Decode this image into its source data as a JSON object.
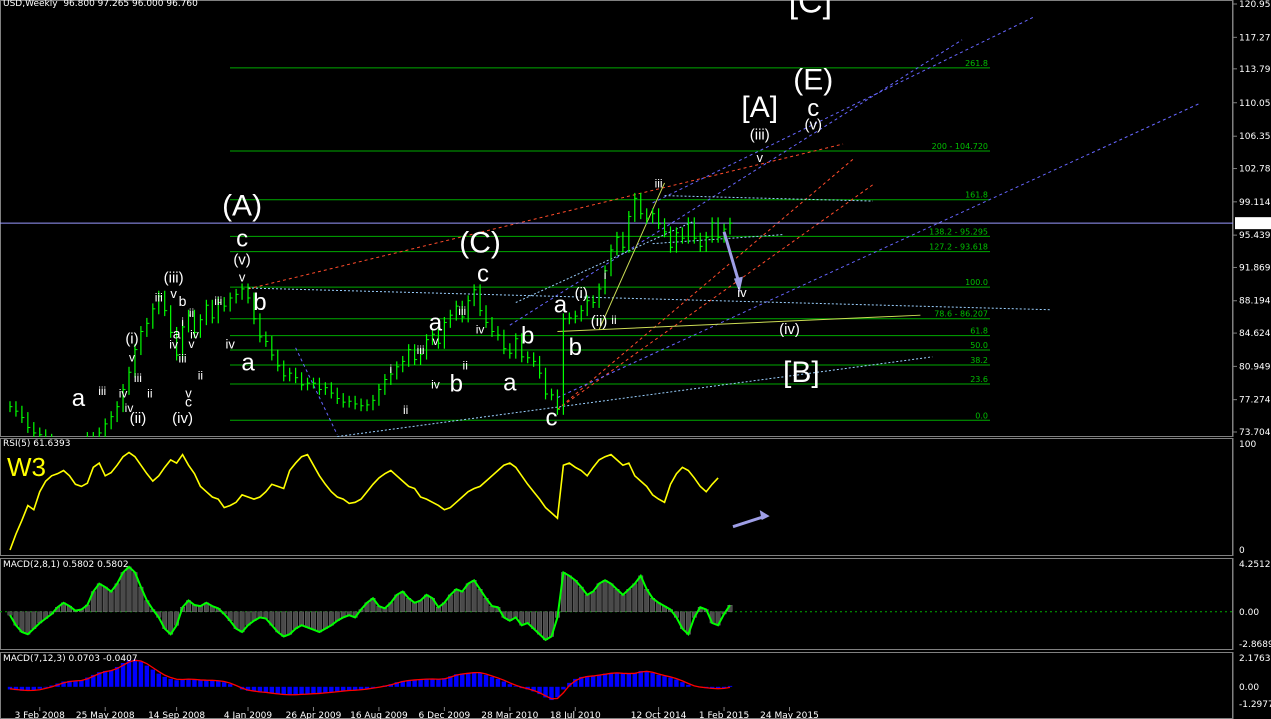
{
  "header": {
    "symbol_text": "USD,Weekly",
    "ohlc_text": "96.800 97.265 96.000 96.760"
  },
  "colors": {
    "bg": "#000000",
    "price": "#00ff00",
    "rsi": "#ffff00",
    "macd_line": "#00ff00",
    "hist": "#4a4a4a",
    "macd2_hist": "#0000ff",
    "macd2_signal": "#ff0000",
    "fib": "#00aa00",
    "current_line": "#9999ff"
  },
  "chart_data": [
    {
      "type": "line",
      "title": "USD,Weekly",
      "ylim": [
        73.704,
        120.955
      ],
      "y_ticks": [
        "120.955",
        "117.275",
        "113.797",
        "110.053",
        "106.359",
        "102.789",
        "99.114",
        "95.439",
        "91.869",
        "88.194",
        "84.624",
        "80.949",
        "77.274",
        "73.704"
      ],
      "current_price": "96.760",
      "x_ticks": [
        "3 Feb 2008",
        "25 May 2008",
        "14 Sep 2008",
        "4 Jan 2009",
        "26 Apr 2009",
        "16 Aug 2009",
        "6 Dec 2009",
        "28 Mar 2010",
        "18 Jul 2010",
        "12 Oct 2014",
        "1 Feb 2015",
        "24 May 2015"
      ],
      "x_tick_idx": [
        5,
        16,
        28,
        40,
        51,
        62,
        73,
        84,
        95,
        109,
        120,
        131
      ],
      "series": [
        {
          "values": [
            76.5,
            76,
            75.3,
            74.2,
            73.6,
            73.4,
            72.9,
            72.4,
            72.2,
            71.5,
            71,
            71.5,
            72.3,
            73.1,
            73,
            73.6,
            74.6,
            75.4,
            76.5,
            78.4,
            80.3,
            82.8,
            84.8,
            85.7,
            87.3,
            88.7,
            87.1,
            84.7,
            82.2,
            85.3,
            86.6,
            84.7,
            86.1,
            87.7,
            86.3,
            88,
            87.6,
            88.5,
            88.9,
            89.5,
            88.5,
            86.2,
            84.2,
            83.7,
            82.2,
            81,
            79.9,
            80.2,
            79.7,
            78.9,
            79.1,
            79.1,
            78.4,
            78.6,
            78,
            77.4,
            77,
            77.1,
            76.8,
            76.6,
            76.7,
            77.2,
            78.4,
            79.5,
            80.1,
            80.9,
            81.5,
            82.8,
            81.7,
            82.3,
            83.9,
            84.5,
            83.5,
            85.8,
            86.6,
            87.6,
            86.4,
            88.2,
            89.4,
            87.1,
            85.8,
            84.8,
            84.4,
            82.9,
            82.4,
            84,
            82,
            81.9,
            81.5,
            80.2,
            77.9,
            77.8,
            76.2,
            86.2,
            86.3,
            86.5,
            87.1,
            88.2,
            88,
            89.5,
            91.5,
            93.8,
            95.2,
            94.1,
            97.5,
            99.5,
            97.8,
            97.3,
            97.8,
            96.7,
            95.8,
            94.1,
            95.7,
            95.1,
            96.8,
            95.1,
            94.2,
            95.2,
            96.8,
            95.2,
            96.1,
            96.76
          ]
        }
      ],
      "fib_levels": [
        {
          "label": "261.8",
          "value": 113.9
        },
        {
          "label": "200 - 104.720",
          "value": 104.72
        },
        {
          "label": "161.8",
          "value": 99.35
        },
        {
          "label": "138.2 - 95.295",
          "value": 95.295
        },
        {
          "label": "127.2 - 93.618",
          "value": 93.618
        },
        {
          "label": "100.0",
          "value": 89.7
        },
        {
          "label": "78.6 - 86.207",
          "value": 86.207
        },
        {
          "label": "61.8",
          "value": 84.35
        },
        {
          "label": "50.0",
          "value": 82.75
        },
        {
          "label": "38.2",
          "value": 81.1
        },
        {
          "label": "23.6",
          "value": 79.0
        },
        {
          "label": "0.0",
          "value": 75.0
        }
      ],
      "annotations": [
        {
          "t": "[C]",
          "c": "#c8902c",
          "s": 34,
          "i": 134.5,
          "v": 120.0
        },
        {
          "t": "[A]",
          "c": "#c8902c",
          "s": 30,
          "i": 126,
          "v": 108.5
        },
        {
          "t": "(E)",
          "c": "#22b0e8",
          "s": 30,
          "i": 135,
          "v": 111.5
        },
        {
          "t": "c",
          "c": "#ff22dd",
          "s": 24,
          "i": 135,
          "v": 108.6
        },
        {
          "t": "(v)",
          "c": "#ff1010",
          "s": 15,
          "i": 135,
          "v": 107.1
        },
        {
          "t": "(iii)",
          "c": "#ff1010",
          "s": 15,
          "i": 126,
          "v": 106.0
        },
        {
          "t": "v",
          "c": "#ffcc00",
          "s": 13,
          "i": 126,
          "v": 103.5
        },
        {
          "t": "iii",
          "c": "#ffcc00",
          "s": 12,
          "i": 109,
          "v": 100.7
        },
        {
          "t": "iv",
          "c": "#ffcc00",
          "s": 13,
          "i": 123,
          "v": 88.6
        },
        {
          "t": "(iv)",
          "c": "#ff1010",
          "s": 15,
          "i": 131,
          "v": 84.5
        },
        {
          "t": "[B]",
          "c": "#c8902c",
          "s": 30,
          "i": 133,
          "v": 79.2
        },
        {
          "t": "(A)",
          "c": "#22b0e8",
          "s": 30,
          "i": 39,
          "v": 97.6
        },
        {
          "t": "c",
          "c": "#ff22dd",
          "s": 24,
          "i": 39,
          "v": 94.2
        },
        {
          "t": "(v)",
          "c": "#ff1010",
          "s": 15,
          "i": 39,
          "v": 92.2
        },
        {
          "t": "v",
          "c": "#ffcc00",
          "s": 13,
          "i": 39,
          "v": 90.3
        },
        {
          "t": "b",
          "c": "#ff22dd",
          "s": 24,
          "i": 42,
          "v": 87.2
        },
        {
          "t": "a",
          "c": "#ff22dd",
          "s": 24,
          "i": 40,
          "v": 80.5
        },
        {
          "t": "iv",
          "c": "#ffcc00",
          "s": 13,
          "i": 37,
          "v": 82.9
        },
        {
          "t": "iii",
          "c": "#ffcc00",
          "s": 12,
          "i": 35,
          "v": 87.7
        },
        {
          "t": "(iii)",
          "c": "#ff1010",
          "s": 15,
          "i": 27.5,
          "v": 90.2
        },
        {
          "t": "iii",
          "c": "#ffcc00",
          "s": 12,
          "i": 25,
          "v": 88.1
        },
        {
          "t": "v",
          "c": "#ffcc00",
          "s": 13,
          "i": 27.5,
          "v": 88.5
        },
        {
          "t": "b",
          "c": "#22b0e8",
          "s": 14,
          "i": 29,
          "v": 87.6
        },
        {
          "t": "a",
          "c": "#22b0e8",
          "s": 14,
          "i": 28,
          "v": 84.0
        },
        {
          "t": "ii",
          "c": "#ffcc00",
          "s": 12,
          "i": 30.5,
          "v": 86.4
        },
        {
          "t": "i",
          "c": "#ffcc00",
          "s": 12,
          "i": 29,
          "v": 85.4
        },
        {
          "t": "iv",
          "c": "#ffcc00",
          "s": 12,
          "i": 27.5,
          "v": 82.9
        },
        {
          "t": "iv",
          "c": "#ffcc00",
          "s": 12,
          "i": 31,
          "v": 84.0
        },
        {
          "t": "v",
          "c": "#ffcc00",
          "s": 12,
          "i": 30.5,
          "v": 83.0
        },
        {
          "t": "iii",
          "c": "#ffcc00",
          "s": 12,
          "i": 29,
          "v": 81.4
        },
        {
          "t": "ii",
          "c": "#ffcc00",
          "s": 12,
          "i": 32,
          "v": 79.5
        },
        {
          "t": "v",
          "c": "#ffcc00",
          "s": 13,
          "i": 30,
          "v": 77.5
        },
        {
          "t": "c",
          "c": "#22b0e8",
          "s": 14,
          "i": 30,
          "v": 76.5
        },
        {
          "t": "(i)",
          "c": "#ff1010",
          "s": 15,
          "i": 20.5,
          "v": 83.5
        },
        {
          "t": "v",
          "c": "#ffcc00",
          "s": 12,
          "i": 20.5,
          "v": 81.5
        },
        {
          "t": "iii",
          "c": "#ffcc00",
          "s": 12,
          "i": 21.5,
          "v": 79.2
        },
        {
          "t": "iv",
          "c": "#ffcc00",
          "s": 12,
          "i": 19,
          "v": 77.5
        },
        {
          "t": "iii",
          "c": "#ffcc00",
          "s": 12,
          "i": 15.5,
          "v": 77.8
        },
        {
          "t": "ii",
          "c": "#ffcc00",
          "s": 12,
          "i": 23.5,
          "v": 77.5
        },
        {
          "t": "iv",
          "c": "#ffcc00",
          "s": 12,
          "i": 20,
          "v": 75.9
        },
        {
          "t": "(ii)",
          "c": "#ff1010",
          "s": 15,
          "i": 21.5,
          "v": 74.7
        },
        {
          "t": "(iv)",
          "c": "#ff1010",
          "s": 15,
          "i": 29,
          "v": 74.7
        },
        {
          "t": "a",
          "c": "#ff22dd",
          "s": 24,
          "i": 11.5,
          "v": 76.6
        },
        {
          "t": "(C)",
          "c": "#22b0e8",
          "s": 30,
          "i": 79,
          "v": 93.5
        },
        {
          "t": "c",
          "c": "#ff22dd",
          "s": 24,
          "i": 79.5,
          "v": 90.3
        },
        {
          "t": "iii",
          "c": "#ffcc00",
          "s": 12,
          "i": 76,
          "v": 86.6
        },
        {
          "t": "iv",
          "c": "#ffcc00",
          "s": 12,
          "i": 79,
          "v": 84.6
        },
        {
          "t": "a",
          "c": "#ff22dd",
          "s": 24,
          "i": 71.5,
          "v": 84.9
        },
        {
          "t": "v",
          "c": "#ffcc00",
          "s": 12,
          "i": 71.5,
          "v": 83.3
        },
        {
          "t": "iii",
          "c": "#ffcc00",
          "s": 12,
          "i": 69,
          "v": 82.3
        },
        {
          "t": "ii",
          "c": "#ffcc00",
          "s": 12,
          "i": 76.5,
          "v": 80.6
        },
        {
          "t": "i",
          "c": "#ffcc00",
          "s": 12,
          "i": 64,
          "v": 80.2
        },
        {
          "t": "iv",
          "c": "#ffcc00",
          "s": 12,
          "i": 71.5,
          "v": 78.5
        },
        {
          "t": "b",
          "c": "#ff22dd",
          "s": 24,
          "i": 75,
          "v": 78.2
        },
        {
          "t": "ii",
          "c": "#ffcc00",
          "s": 12,
          "i": 66.5,
          "v": 75.7
        },
        {
          "t": "a",
          "c": "#ff22dd",
          "s": 24,
          "i": 84,
          "v": 78.3
        },
        {
          "t": "b",
          "c": "#ff22dd",
          "s": 24,
          "i": 87,
          "v": 83.5
        },
        {
          "t": "c",
          "c": "#ff22dd",
          "s": 24,
          "i": 91,
          "v": 74.4
        },
        {
          "t": "a",
          "c": "#ff22dd",
          "s": 24,
          "i": 92.5,
          "v": 86.9
        },
        {
          "t": "(i)",
          "c": "#ff1010",
          "s": 15,
          "i": 96,
          "v": 88.5
        },
        {
          "t": "b",
          "c": "#ff22dd",
          "s": 24,
          "i": 95,
          "v": 82.2
        },
        {
          "t": "i",
          "c": "#ffcc00",
          "s": 12,
          "i": 100,
          "v": 90.6
        },
        {
          "t": "ii",
          "c": "#ffcc00",
          "s": 12,
          "i": 101.5,
          "v": 85.6
        },
        {
          "t": "(ii)",
          "c": "#ff1010",
          "s": 15,
          "i": 99,
          "v": 85.4
        }
      ]
    },
    {
      "type": "line",
      "title": "RSI(5) 61.6393",
      "ylim": [
        0,
        100
      ],
      "y_ticks": [
        "100",
        "0"
      ],
      "label": "W3",
      "values": [
        0,
        15,
        28,
        42,
        38,
        55,
        65,
        70,
        72,
        75,
        70,
        62,
        60,
        63,
        78,
        82,
        70,
        73,
        80,
        88,
        92,
        88,
        80,
        72,
        65,
        70,
        78,
        85,
        82,
        90,
        80,
        72,
        60,
        55,
        50,
        48,
        40,
        42,
        45,
        52,
        50,
        48,
        50,
        55,
        62,
        60,
        58,
        75,
        82,
        88,
        90,
        80,
        70,
        62,
        55,
        50,
        48,
        44,
        45,
        48,
        55,
        62,
        68,
        72,
        75,
        70,
        65,
        60,
        58,
        50,
        48,
        45,
        42,
        38,
        40,
        45,
        50,
        55,
        58,
        60,
        65,
        70,
        75,
        80,
        82,
        78,
        70,
        62,
        55,
        48,
        40,
        35,
        30,
        80,
        82,
        78,
        75,
        70,
        78,
        85,
        88,
        90,
        85,
        80,
        82,
        70,
        65,
        60,
        52,
        48,
        45,
        62,
        72,
        78,
        75,
        68,
        60,
        55,
        62,
        68
      ]
    },
    {
      "type": "bar",
      "title": "MACD(2,8,1) 0.5802 0.5802",
      "ylim": [
        -2.8689,
        4.2512
      ],
      "y_ticks": [
        "4.2512",
        "0.00",
        "-2.8689"
      ],
      "values": [
        -0.3,
        -1.2,
        -1.8,
        -2.0,
        -1.5,
        -1.0,
        -0.6,
        -0.2,
        0.4,
        0.8,
        0.5,
        0.1,
        0.2,
        0.6,
        1.8,
        2.5,
        2.2,
        1.8,
        2.5,
        3.5,
        4.0,
        3.5,
        2.2,
        1.0,
        0.2,
        -0.5,
        -1.5,
        -2.0,
        -1.2,
        0.4,
        1.0,
        0.6,
        0.5,
        0.8,
        0.5,
        0.3,
        -0.2,
        -0.8,
        -1.5,
        -1.8,
        -1.2,
        -0.8,
        -0.5,
        -0.6,
        -1.2,
        -1.8,
        -2.2,
        -2.0,
        -1.5,
        -1.2,
        -1.4,
        -1.6,
        -1.8,
        -1.5,
        -1.2,
        -0.8,
        -0.5,
        -0.3,
        -0.5,
        0.2,
        0.8,
        1.2,
        0.5,
        0.3,
        0.8,
        1.5,
        1.8,
        1.2,
        0.8,
        1.0,
        1.5,
        1.2,
        0.4,
        0.8,
        1.5,
        2.0,
        1.8,
        2.5,
        2.8,
        2.0,
        1.2,
        0.5,
        0.4,
        -0.5,
        -0.8,
        -0.5,
        -1.2,
        -1.0,
        -1.5,
        -2.0,
        -2.5,
        -2.2,
        -0.5,
        3.5,
        3.2,
        2.8,
        2.2,
        1.5,
        1.8,
        2.5,
        2.8,
        2.5,
        2.0,
        1.5,
        2.0,
        2.5,
        3.2,
        2.0,
        1.2,
        0.8,
        0.5,
        0.2,
        -0.5,
        -1.5,
        -2.0,
        -0.5,
        0.4,
        0.2,
        -1.0,
        -1.2,
        -0.2,
        0.58
      ]
    },
    {
      "type": "bar",
      "title": "MACD(7,12,3) 0.0703 -0.0407",
      "ylim": [
        -1.2977,
        2.1763
      ],
      "y_ticks": [
        "2.1763",
        "0.00",
        "-1.2977"
      ],
      "values": [
        -0.2,
        -0.25,
        -0.3,
        -0.3,
        -0.25,
        -0.15,
        -0.05,
        0.1,
        0.25,
        0.4,
        0.45,
        0.45,
        0.5,
        0.7,
        0.9,
        1.1,
        1.2,
        1.25,
        1.5,
        1.8,
        2.0,
        2.05,
        1.9,
        1.6,
        1.3,
        1.0,
        0.75,
        0.6,
        0.5,
        0.55,
        0.6,
        0.55,
        0.5,
        0.5,
        0.48,
        0.45,
        0.35,
        0.2,
        0.0,
        -0.2,
        -0.3,
        -0.35,
        -0.4,
        -0.45,
        -0.5,
        -0.55,
        -0.6,
        -0.62,
        -0.6,
        -0.55,
        -0.55,
        -0.5,
        -0.48,
        -0.45,
        -0.4,
        -0.35,
        -0.3,
        -0.25,
        -0.25,
        -0.2,
        -0.15,
        -0.05,
        0.0,
        0.1,
        0.2,
        0.35,
        0.45,
        0.5,
        0.55,
        0.55,
        0.6,
        0.6,
        0.55,
        0.65,
        0.8,
        0.95,
        1.0,
        1.05,
        1.1,
        1.05,
        0.9,
        0.75,
        0.6,
        0.4,
        0.2,
        0.05,
        -0.1,
        -0.2,
        -0.35,
        -0.55,
        -0.8,
        -1.0,
        -0.8,
        -0.2,
        0.3,
        0.6,
        0.75,
        0.8,
        0.85,
        0.9,
        1.0,
        1.05,
        1.05,
        1.0,
        1.0,
        1.05,
        1.2,
        1.15,
        1.05,
        0.9,
        0.8,
        0.7,
        0.55,
        0.35,
        0.15,
        0.0,
        -0.05,
        -0.1,
        -0.15,
        -0.15,
        -0.1,
        0.07
      ],
      "signal": [
        -0.15,
        -0.2,
        -0.25,
        -0.28,
        -0.27,
        -0.22,
        -0.12,
        0.0,
        0.15,
        0.3,
        0.4,
        0.45,
        0.48,
        0.6,
        0.8,
        1.0,
        1.15,
        1.22,
        1.38,
        1.62,
        1.88,
        2.0,
        1.95,
        1.75,
        1.45,
        1.15,
        0.88,
        0.7,
        0.57,
        0.55,
        0.58,
        0.56,
        0.52,
        0.5,
        0.49,
        0.46,
        0.4,
        0.28,
        0.1,
        -0.1,
        -0.25,
        -0.32,
        -0.38,
        -0.42,
        -0.48,
        -0.53,
        -0.58,
        -0.6,
        -0.6,
        -0.57,
        -0.55,
        -0.52,
        -0.5,
        -0.46,
        -0.42,
        -0.37,
        -0.32,
        -0.28,
        -0.26,
        -0.22,
        -0.17,
        -0.1,
        -0.03,
        0.05,
        0.15,
        0.28,
        0.4,
        0.48,
        0.52,
        0.55,
        0.58,
        0.59,
        0.57,
        0.6,
        0.72,
        0.88,
        0.97,
        1.02,
        1.07,
        1.07,
        0.97,
        0.82,
        0.67,
        0.5,
        0.3,
        0.12,
        -0.03,
        -0.15,
        -0.28,
        -0.45,
        -0.68,
        -0.9,
        -0.88,
        -0.45,
        0.1,
        0.45,
        0.68,
        0.78,
        0.82,
        0.88,
        0.95,
        1.02,
        1.05,
        1.02,
        1.0,
        1.02,
        1.12,
        1.17,
        1.1,
        0.97,
        0.85,
        0.75,
        0.62,
        0.45,
        0.25,
        0.07,
        -0.02,
        -0.07,
        -0.12,
        -0.14,
        -0.12,
        -0.04
      ]
    }
  ]
}
